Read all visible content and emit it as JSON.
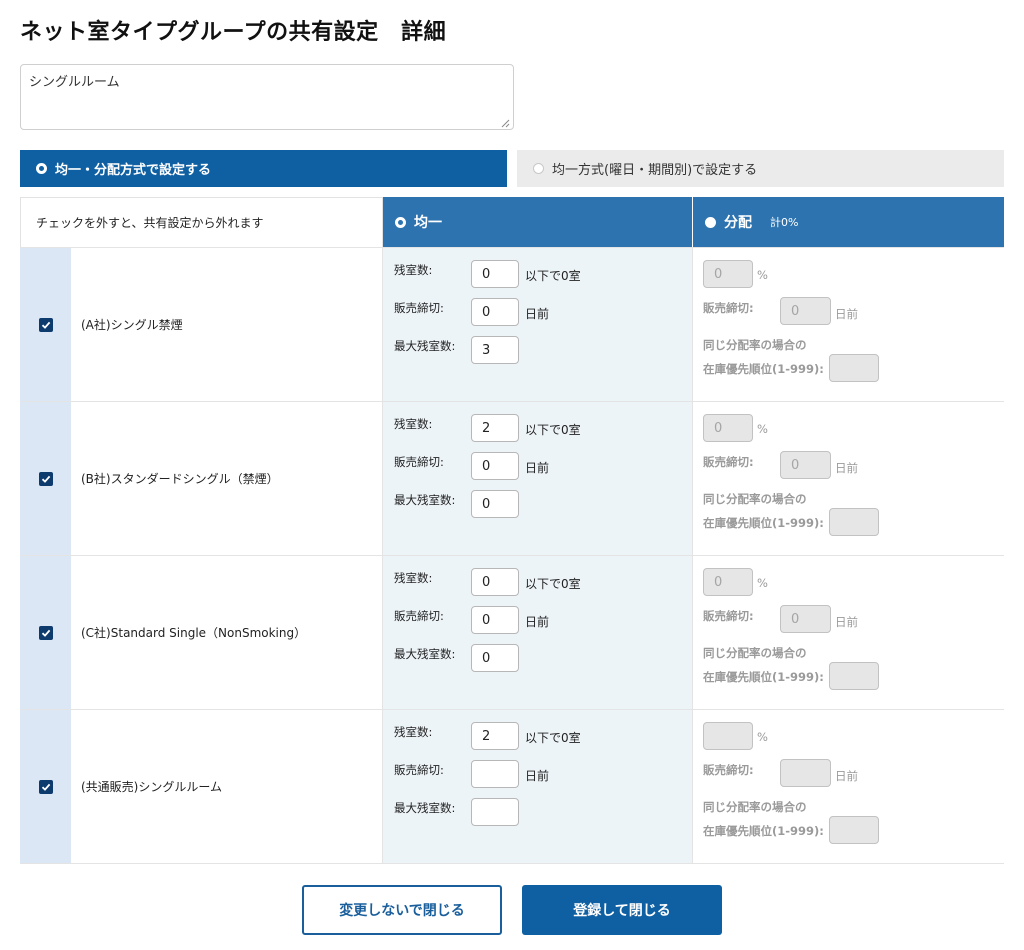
{
  "page": {
    "title": "ネット室タイプグループの共有設定　詳細"
  },
  "memo": {
    "value": "シングルルーム"
  },
  "mode_tabs": [
    {
      "label": "均一・分配方式で設定する",
      "selected": true
    },
    {
      "label": "均一方式(曜日・期間別)で設定する",
      "selected": false
    }
  ],
  "table": {
    "note": "チェックを外すと、共有設定から外れます",
    "even_header": "均一",
    "dist_header": "分配",
    "dist_total": "計0%",
    "labels": {
      "remaining": "残室数:",
      "remaining_suffix": "以下で0室",
      "cutoff": "販売締切:",
      "days_before": "日前",
      "max_remaining": "最大残室数:",
      "percent": "%",
      "same_rate_line1": "同じ分配率の場合の",
      "same_rate_line2": "在庫優先順位(1-999):"
    },
    "rows": [
      {
        "checked": true,
        "name": "(A社)シングル禁煙",
        "remaining": "0",
        "cutoff": "0",
        "max_remaining": "3",
        "dist_percent": "0",
        "dist_cutoff": "0",
        "priority": ""
      },
      {
        "checked": true,
        "name": "(B社)スタンダードシングル（禁煙）",
        "remaining": "2",
        "cutoff": "0",
        "max_remaining": "0",
        "dist_percent": "0",
        "dist_cutoff": "0",
        "priority": ""
      },
      {
        "checked": true,
        "name": "(C社)Standard Single（NonSmoking）",
        "remaining": "0",
        "cutoff": "0",
        "max_remaining": "0",
        "dist_percent": "0",
        "dist_cutoff": "0",
        "priority": ""
      },
      {
        "checked": true,
        "name": "(共通販売)シングルルーム",
        "remaining": "2",
        "cutoff": "",
        "max_remaining": "",
        "dist_percent": "",
        "dist_cutoff": "",
        "priority": ""
      }
    ]
  },
  "buttons": {
    "close_without_change": "変更しないで閉じる",
    "register_and_close": "登録して閉じる"
  }
}
